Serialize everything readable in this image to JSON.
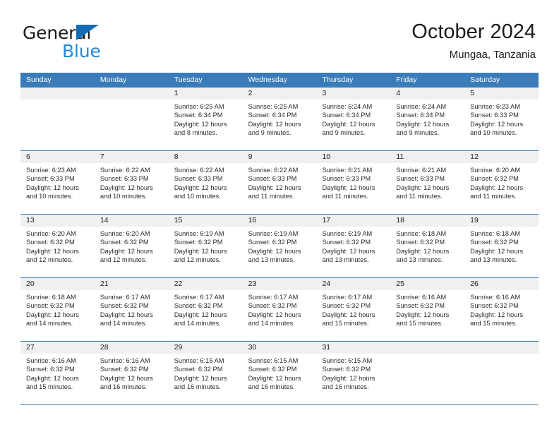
{
  "brand": {
    "line1": "General",
    "line2": "Blue",
    "triangle_color": "#136bb5"
  },
  "header": {
    "title": "October 2024",
    "subtitle": "Mungaa, Tanzania"
  },
  "theme": {
    "header_blue": "#3a7cba",
    "band_gray": "#f0f0f0",
    "text_dark": "#1b1b1b",
    "brand_blue": "#2389d6"
  },
  "weekdays": [
    "Sunday",
    "Monday",
    "Tuesday",
    "Wednesday",
    "Thursday",
    "Friday",
    "Saturday"
  ],
  "weeks": [
    [
      {
        "day": "",
        "sunrise": "",
        "sunset": "",
        "daylight1": "",
        "daylight2": ""
      },
      {
        "day": "",
        "sunrise": "",
        "sunset": "",
        "daylight1": "",
        "daylight2": ""
      },
      {
        "day": "1",
        "sunrise": "Sunrise: 6:25 AM",
        "sunset": "Sunset: 6:34 PM",
        "daylight1": "Daylight: 12 hours",
        "daylight2": "and 8 minutes."
      },
      {
        "day": "2",
        "sunrise": "Sunrise: 6:25 AM",
        "sunset": "Sunset: 6:34 PM",
        "daylight1": "Daylight: 12 hours",
        "daylight2": "and 9 minutes."
      },
      {
        "day": "3",
        "sunrise": "Sunrise: 6:24 AM",
        "sunset": "Sunset: 6:34 PM",
        "daylight1": "Daylight: 12 hours",
        "daylight2": "and 9 minutes."
      },
      {
        "day": "4",
        "sunrise": "Sunrise: 6:24 AM",
        "sunset": "Sunset: 6:34 PM",
        "daylight1": "Daylight: 12 hours",
        "daylight2": "and 9 minutes."
      },
      {
        "day": "5",
        "sunrise": "Sunrise: 6:23 AM",
        "sunset": "Sunset: 6:33 PM",
        "daylight1": "Daylight: 12 hours",
        "daylight2": "and 10 minutes."
      }
    ],
    [
      {
        "day": "6",
        "sunrise": "Sunrise: 6:23 AM",
        "sunset": "Sunset: 6:33 PM",
        "daylight1": "Daylight: 12 hours",
        "daylight2": "and 10 minutes."
      },
      {
        "day": "7",
        "sunrise": "Sunrise: 6:22 AM",
        "sunset": "Sunset: 6:33 PM",
        "daylight1": "Daylight: 12 hours",
        "daylight2": "and 10 minutes."
      },
      {
        "day": "8",
        "sunrise": "Sunrise: 6:22 AM",
        "sunset": "Sunset: 6:33 PM",
        "daylight1": "Daylight: 12 hours",
        "daylight2": "and 10 minutes."
      },
      {
        "day": "9",
        "sunrise": "Sunrise: 6:22 AM",
        "sunset": "Sunset: 6:33 PM",
        "daylight1": "Daylight: 12 hours",
        "daylight2": "and 11 minutes."
      },
      {
        "day": "10",
        "sunrise": "Sunrise: 6:21 AM",
        "sunset": "Sunset: 6:33 PM",
        "daylight1": "Daylight: 12 hours",
        "daylight2": "and 11 minutes."
      },
      {
        "day": "11",
        "sunrise": "Sunrise: 6:21 AM",
        "sunset": "Sunset: 6:33 PM",
        "daylight1": "Daylight: 12 hours",
        "daylight2": "and 11 minutes."
      },
      {
        "day": "12",
        "sunrise": "Sunrise: 6:20 AM",
        "sunset": "Sunset: 6:32 PM",
        "daylight1": "Daylight: 12 hours",
        "daylight2": "and 11 minutes."
      }
    ],
    [
      {
        "day": "13",
        "sunrise": "Sunrise: 6:20 AM",
        "sunset": "Sunset: 6:32 PM",
        "daylight1": "Daylight: 12 hours",
        "daylight2": "and 12 minutes."
      },
      {
        "day": "14",
        "sunrise": "Sunrise: 6:20 AM",
        "sunset": "Sunset: 6:32 PM",
        "daylight1": "Daylight: 12 hours",
        "daylight2": "and 12 minutes."
      },
      {
        "day": "15",
        "sunrise": "Sunrise: 6:19 AM",
        "sunset": "Sunset: 6:32 PM",
        "daylight1": "Daylight: 12 hours",
        "daylight2": "and 12 minutes."
      },
      {
        "day": "16",
        "sunrise": "Sunrise: 6:19 AM",
        "sunset": "Sunset: 6:32 PM",
        "daylight1": "Daylight: 12 hours",
        "daylight2": "and 13 minutes."
      },
      {
        "day": "17",
        "sunrise": "Sunrise: 6:19 AM",
        "sunset": "Sunset: 6:32 PM",
        "daylight1": "Daylight: 12 hours",
        "daylight2": "and 13 minutes."
      },
      {
        "day": "18",
        "sunrise": "Sunrise: 6:18 AM",
        "sunset": "Sunset: 6:32 PM",
        "daylight1": "Daylight: 12 hours",
        "daylight2": "and 13 minutes."
      },
      {
        "day": "19",
        "sunrise": "Sunrise: 6:18 AM",
        "sunset": "Sunset: 6:32 PM",
        "daylight1": "Daylight: 12 hours",
        "daylight2": "and 13 minutes."
      }
    ],
    [
      {
        "day": "20",
        "sunrise": "Sunrise: 6:18 AM",
        "sunset": "Sunset: 6:32 PM",
        "daylight1": "Daylight: 12 hours",
        "daylight2": "and 14 minutes."
      },
      {
        "day": "21",
        "sunrise": "Sunrise: 6:17 AM",
        "sunset": "Sunset: 6:32 PM",
        "daylight1": "Daylight: 12 hours",
        "daylight2": "and 14 minutes."
      },
      {
        "day": "22",
        "sunrise": "Sunrise: 6:17 AM",
        "sunset": "Sunset: 6:32 PM",
        "daylight1": "Daylight: 12 hours",
        "daylight2": "and 14 minutes."
      },
      {
        "day": "23",
        "sunrise": "Sunrise: 6:17 AM",
        "sunset": "Sunset: 6:32 PM",
        "daylight1": "Daylight: 12 hours",
        "daylight2": "and 14 minutes."
      },
      {
        "day": "24",
        "sunrise": "Sunrise: 6:17 AM",
        "sunset": "Sunset: 6:32 PM",
        "daylight1": "Daylight: 12 hours",
        "daylight2": "and 15 minutes."
      },
      {
        "day": "25",
        "sunrise": "Sunrise: 6:16 AM",
        "sunset": "Sunset: 6:32 PM",
        "daylight1": "Daylight: 12 hours",
        "daylight2": "and 15 minutes."
      },
      {
        "day": "26",
        "sunrise": "Sunrise: 6:16 AM",
        "sunset": "Sunset: 6:32 PM",
        "daylight1": "Daylight: 12 hours",
        "daylight2": "and 15 minutes."
      }
    ],
    [
      {
        "day": "27",
        "sunrise": "Sunrise: 6:16 AM",
        "sunset": "Sunset: 6:32 PM",
        "daylight1": "Daylight: 12 hours",
        "daylight2": "and 15 minutes."
      },
      {
        "day": "28",
        "sunrise": "Sunrise: 6:16 AM",
        "sunset": "Sunset: 6:32 PM",
        "daylight1": "Daylight: 12 hours",
        "daylight2": "and 16 minutes."
      },
      {
        "day": "29",
        "sunrise": "Sunrise: 6:15 AM",
        "sunset": "Sunset: 6:32 PM",
        "daylight1": "Daylight: 12 hours",
        "daylight2": "and 16 minutes."
      },
      {
        "day": "30",
        "sunrise": "Sunrise: 6:15 AM",
        "sunset": "Sunset: 6:32 PM",
        "daylight1": "Daylight: 12 hours",
        "daylight2": "and 16 minutes."
      },
      {
        "day": "31",
        "sunrise": "Sunrise: 6:15 AM",
        "sunset": "Sunset: 6:32 PM",
        "daylight1": "Daylight: 12 hours",
        "daylight2": "and 16 minutes."
      },
      {
        "day": "",
        "sunrise": "",
        "sunset": "",
        "daylight1": "",
        "daylight2": ""
      },
      {
        "day": "",
        "sunrise": "",
        "sunset": "",
        "daylight1": "",
        "daylight2": ""
      }
    ]
  ]
}
